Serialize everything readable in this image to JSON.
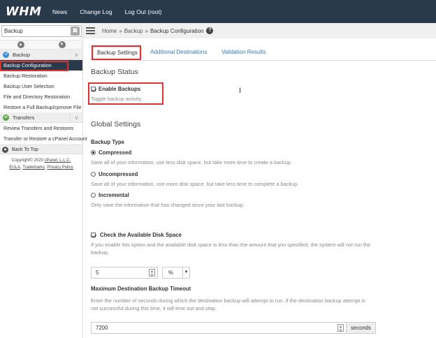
{
  "topbar": {
    "logo": "WHM",
    "nav": [
      "News",
      "Change Log",
      "Log Out (root)"
    ]
  },
  "sidebar": {
    "search_value": "Backup",
    "clear_glyph": "✖",
    "categories": [
      {
        "label": "Backup",
        "icon_color": "#3b8ed1",
        "items": [
          "Backup Configuration",
          "Backup Restoration",
          "Backup User Selection",
          "File and Directory Restoration",
          "Restore a Full Backup/cpmove File"
        ]
      },
      {
        "label": "Transfers",
        "icon_color": "#5aa645",
        "items": [
          "Review Transfers and Restores",
          "Transfer or Restore a cPanel Account"
        ]
      }
    ],
    "back_to_top": "Back To Top",
    "copyright": "Copyright© 2020",
    "company": "cPanel, L.L.C.",
    "links": [
      "EULA",
      "Trademarks",
      "Privacy Policy"
    ]
  },
  "breadcrumb": {
    "home": "Home",
    "section": "Backup",
    "current": "Backup Configuration",
    "help": "?"
  },
  "tabs": [
    "Backup Settings",
    "Additional Destinations",
    "Validation Results"
  ],
  "backup_status": {
    "heading": "Backup Status",
    "enable_label": "Enable Backups",
    "enable_desc": "Toggle backup activity."
  },
  "global_settings": {
    "heading": "Global Settings",
    "type_label": "Backup Type",
    "options": [
      {
        "label": "Compressed",
        "desc": "Save all of your information, use less disk space, but take more time to create a backup.",
        "selected": true
      },
      {
        "label": "Uncompressed",
        "desc": "Save all of your information, use more disk space, but take less time to complete a backup.",
        "selected": false
      },
      {
        "label": "Incremental",
        "desc": "Only save the information that has changed since your last backup.",
        "selected": false
      }
    ],
    "disk_check_label": "Check the Available Disk Space",
    "disk_check_desc": "If you enable this option and the available disk space is less than the amount that you specified, the system will not run the backup.",
    "disk_value": "5",
    "disk_unit": "%",
    "timeout_label": "Maximum Destination Backup Timeout",
    "timeout_desc": "Enter the number of seconds during which the destination backup will attempt to run. If the destination backup attempt is not successful during this time, it will time out and stop.",
    "timeout_value": "7200",
    "timeout_unit": "seconds"
  },
  "colors": {
    "topbar": "#293a4a",
    "link": "#337ab7",
    "highlight": "#dd3333"
  }
}
